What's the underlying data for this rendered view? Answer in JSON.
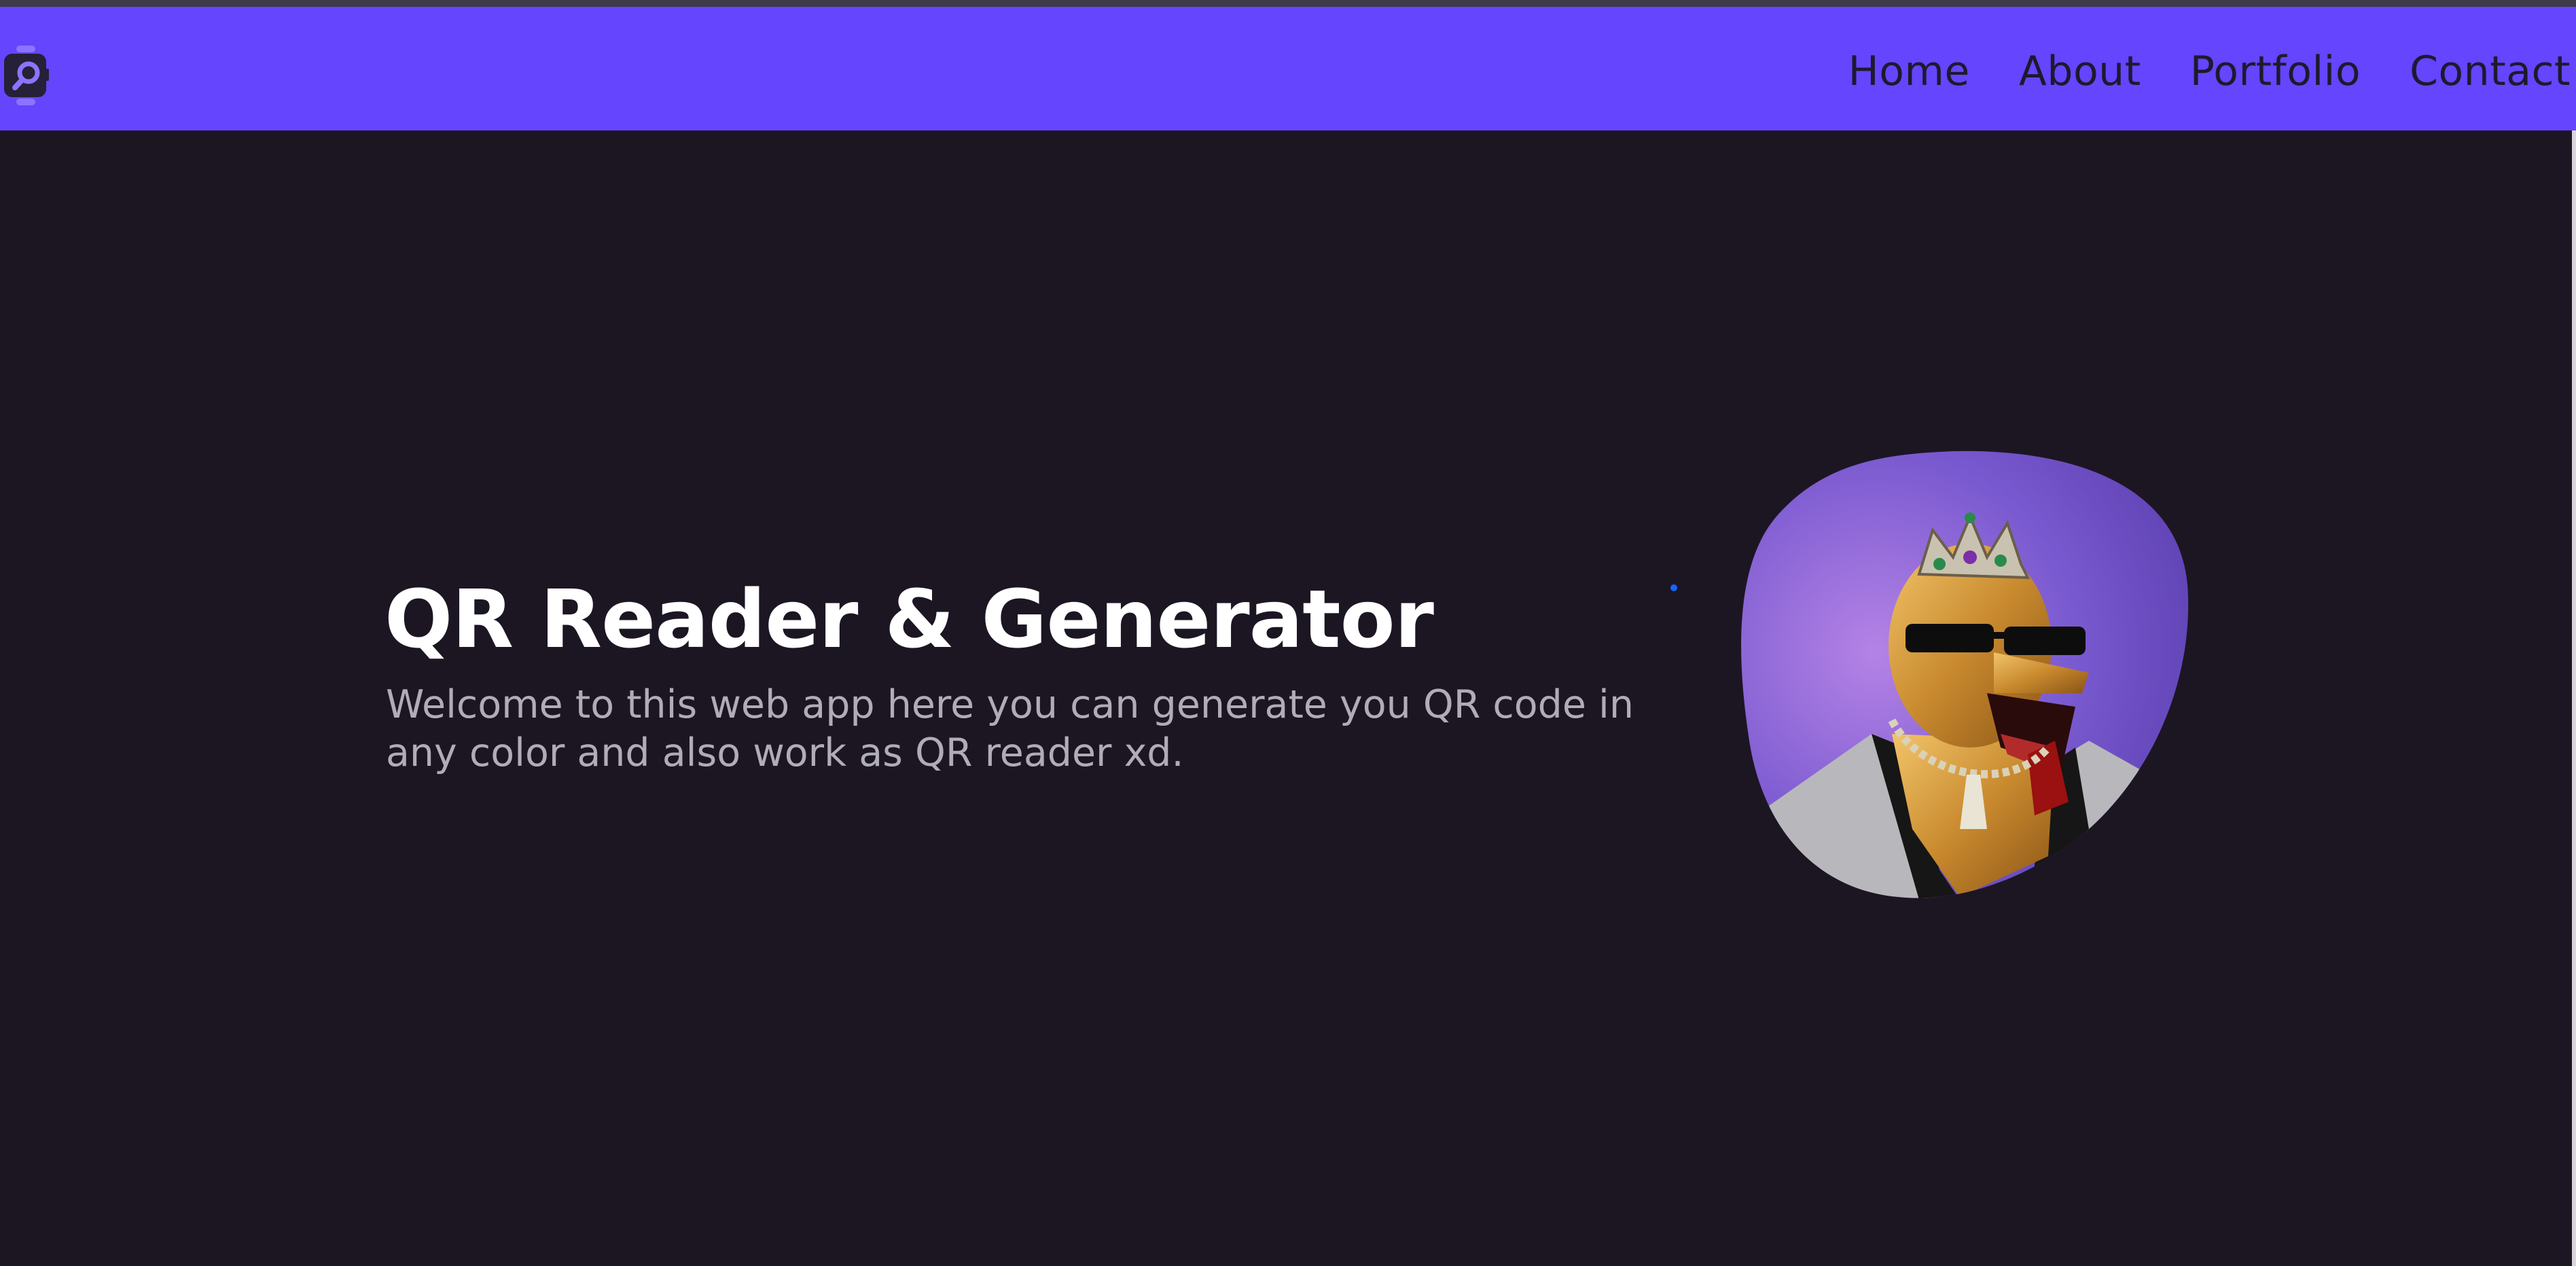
{
  "app": {
    "logo_icon": "qr-search-icon"
  },
  "nav": {
    "links": [
      {
        "label": "Home"
      },
      {
        "label": "About"
      },
      {
        "label": "Portfolio"
      },
      {
        "label": "Contact"
      }
    ]
  },
  "hero": {
    "title": "QR Reader & Generator",
    "subtitle": "Welcome to this web app here you can generate you QR code in any color and also work as QR reader xd.",
    "image_icon": "golden-leopard-king-avatar"
  },
  "colors": {
    "navbar": "#6545fd",
    "background": "#1c1623",
    "title": "#ffffff",
    "subtitle": "#b0acb8",
    "nav_text": "#1e1a2e",
    "blob": "#8a6ad8"
  }
}
